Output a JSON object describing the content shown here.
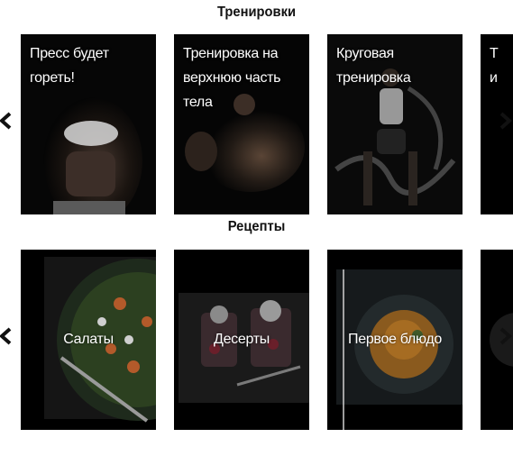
{
  "sections": {
    "workouts": {
      "title": "Тренировки",
      "cards": [
        {
          "label": "Пресс будет гореть!"
        },
        {
          "label": "Тренировка на верхнюю часть тела"
        },
        {
          "label": "Круговая тренировка"
        },
        {
          "label": "Т и"
        }
      ]
    },
    "recipes": {
      "title": "Рецепты",
      "cards": [
        {
          "label": "Салаты"
        },
        {
          "label": "Десерты"
        },
        {
          "label": "Первое блюдо"
        },
        {
          "label": ""
        }
      ]
    }
  },
  "icons": {
    "prev": "chevron-left-icon",
    "next": "chevron-right-icon"
  },
  "colors": {
    "card_bg": "#000000",
    "text": "#ffffff",
    "arrow": "#111111"
  }
}
